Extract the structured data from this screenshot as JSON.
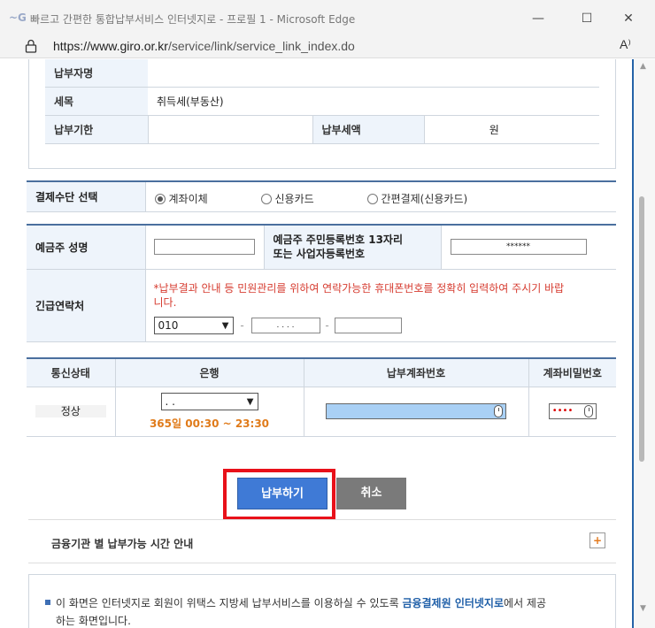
{
  "window": {
    "title": "빠르고 간편한 통합납부서비스 인터넷지로 - 프로필 1 - Microsoft Edge",
    "url_host": "https://www.giro.or.kr",
    "url_path": "/service/link/service_link_index.do",
    "min_glyph": "—",
    "max_glyph": "☐",
    "close_glyph": "✕",
    "read_aloud": "A⁾"
  },
  "summary": {
    "payer_name_label": "납부자명",
    "payer_name_value": "",
    "tax_item_label": "세목",
    "tax_item_value": "취득세(부동산)",
    "due_date_label": "납부기한",
    "due_date_value": "",
    "amount_label": "납부세액",
    "amount_unit": "원"
  },
  "payment_method": {
    "label": "결제수단 선택",
    "options": [
      {
        "label": "계좌이체",
        "selected": true
      },
      {
        "label": "신용카드",
        "selected": false
      },
      {
        "label": "간편결제(신용카드)",
        "selected": false
      }
    ]
  },
  "depositor": {
    "name_label": "예금주 성명",
    "name_value": "",
    "id_label_line1": "예금주 주민등록번호 13자리",
    "id_label_line2": "또는 사업자등록번호",
    "id_value": "******",
    "contact_label": "긴급연락처",
    "contact_warning_line1": "*납부결과 안내 등 민원관리를 위하여 연락가능한 휴대폰번호를 정확히 입력하여 주시기 바랍",
    "contact_warning_line2": "니다.",
    "phone_prefix": "010",
    "phone_middle": ". . . .",
    "phone_sep": "-",
    "phone_last": ""
  },
  "bank": {
    "headers": [
      "통신상태",
      "은행",
      "납부계좌번호",
      "계좌비밀번호"
    ],
    "status_value": "정상",
    "bank_selected": ".  .",
    "hours": "365일 00:30 ~ 23:30",
    "account_value": "",
    "password_value": "••••"
  },
  "buttons": {
    "pay": "납부하기",
    "cancel": "취소",
    "expand": "+"
  },
  "info": {
    "title": "금융기관 별 납부가능 시간 안내"
  },
  "notice": {
    "text_prefix": "이 화면은 인터넷지로 회원이 위택스 지방세 납부서비스를 이용하실 수 있도록 ",
    "text_link": "금융결제원 인터넷지로",
    "text_suffix": "에서 제공",
    "text_line2": "하는 화면입니다."
  },
  "colors": {
    "accent_blue": "#3f7ad6",
    "highlight_red": "#e8111a",
    "hours_orange": "#e07b1a",
    "warning_red": "#d63b2f"
  }
}
